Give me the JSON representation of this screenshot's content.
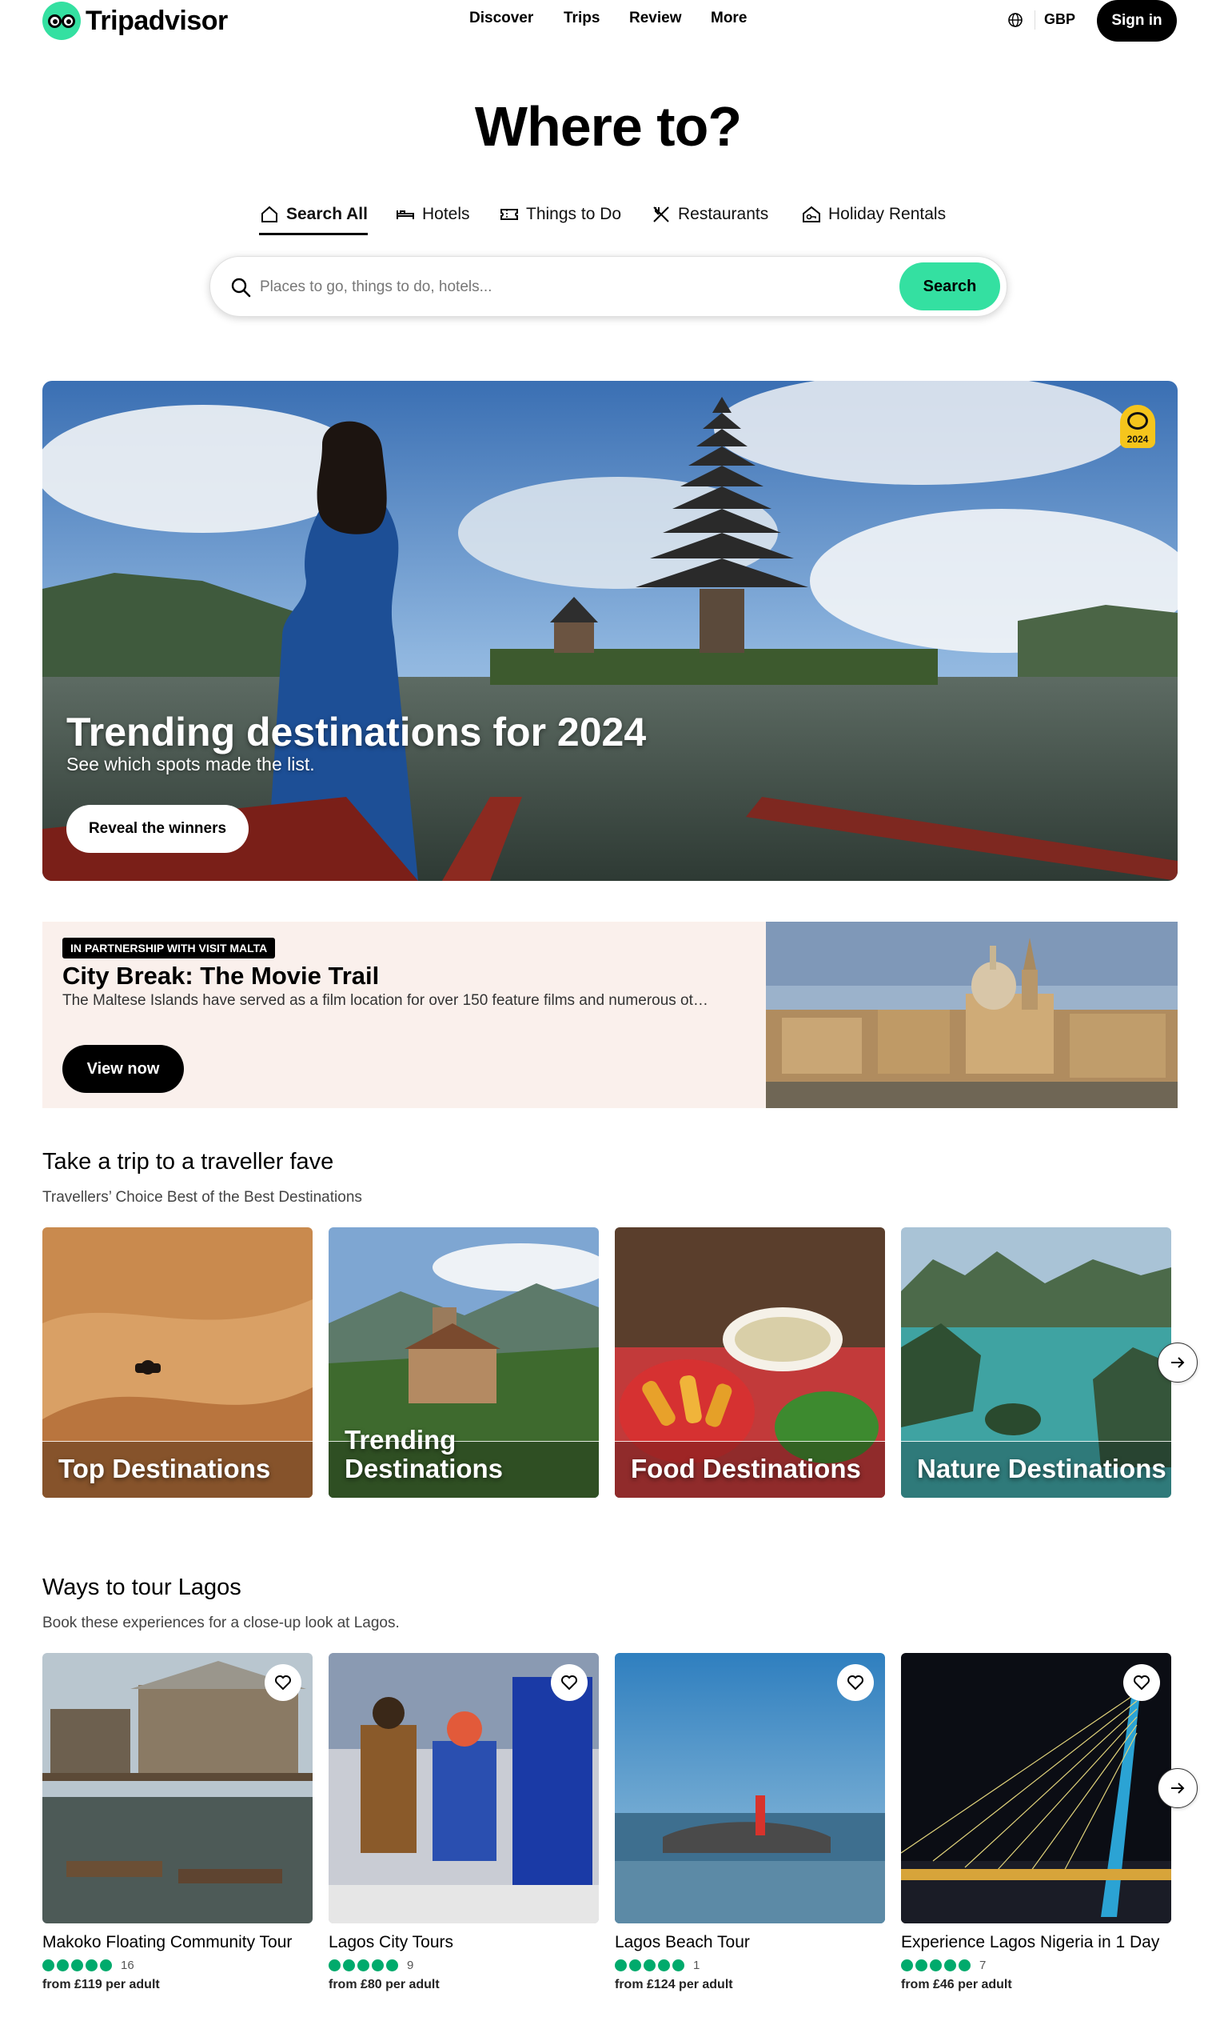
{
  "brand": {
    "name": "Tripadvisor"
  },
  "nav": {
    "items": [
      "Discover",
      "Trips",
      "Review",
      "More"
    ]
  },
  "header": {
    "currency": "GBP",
    "signin": "Sign in"
  },
  "hero": {
    "title": "Where to?",
    "tabs": [
      "Search All",
      "Hotels",
      "Things to Do",
      "Restaurants",
      "Holiday Rentals"
    ],
    "active_tab": "Search All",
    "search_placeholder": "Places to go, things to do, hotels...",
    "search_button": "Search"
  },
  "trending": {
    "badge_year": "2024",
    "title": "Trending destinations for 2024",
    "subtitle": "See which spots made the list.",
    "button": "Reveal the winners"
  },
  "partner": {
    "tag": "IN PARTNERSHIP WITH VISIT MALTA",
    "title": "City Break: The Movie Trail",
    "description": "The Maltese Islands have served as a film location for over 150 feature films and numerous ot…",
    "button": "View now"
  },
  "faves": {
    "title": "Take a trip to a traveller fave",
    "subtitle": "Travellers’ Choice Best of the Best Destinations",
    "cards": [
      {
        "label": "Top Destinations"
      },
      {
        "label": "Trending Destinations"
      },
      {
        "label": "Food Destinations"
      },
      {
        "label": "Nature Destinations"
      }
    ]
  },
  "tours": {
    "title": "Ways to tour Lagos",
    "subtitle": "Book these experiences for a close-up look at Lagos.",
    "cards": [
      {
        "name": "Makoko Floating Community Tour",
        "rating": 5,
        "reviews": "16",
        "price": "from £119 per adult"
      },
      {
        "name": "Lagos City Tours",
        "rating": 5,
        "reviews": "9",
        "price": "from £80 per adult"
      },
      {
        "name": "Lagos Beach Tour",
        "rating": 5,
        "reviews": "1",
        "price": "from £124 per adult"
      },
      {
        "name": "Experience Lagos Nigeria in 1 Day",
        "rating": 5,
        "reviews": "7",
        "price": "from £46 per adult"
      }
    ]
  },
  "colors": {
    "brand_green": "#34e0a1",
    "rating_green": "#00aa6c",
    "partner_bg": "#faf0ec"
  }
}
